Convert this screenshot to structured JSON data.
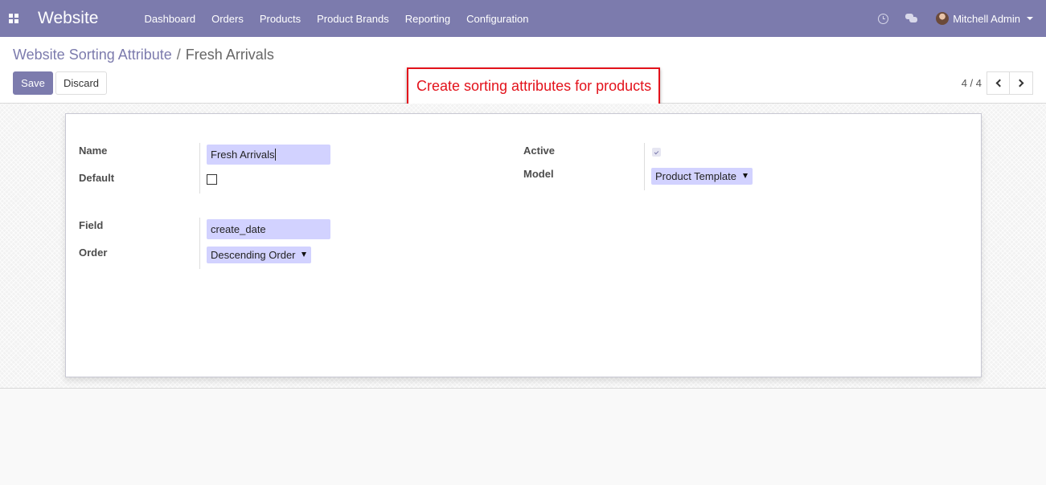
{
  "navbar": {
    "brand": "Website",
    "menu": [
      "Dashboard",
      "Orders",
      "Products",
      "Product Brands",
      "Reporting",
      "Configuration"
    ],
    "user": "Mitchell Admin",
    "color": "#7c7bad"
  },
  "breadcrumb": {
    "parent": "Website Sorting Attribute",
    "separator": "/",
    "current": "Fresh Arrivals"
  },
  "buttons": {
    "save": "Save",
    "discard": "Discard"
  },
  "annotation": "Create sorting attributes for products",
  "pager": {
    "value": "4 / 4"
  },
  "form": {
    "name_label": "Name",
    "name_value": "Fresh Arrivals",
    "default_label": "Default",
    "default_checked": false,
    "active_label": "Active",
    "active_checked": true,
    "model_label": "Model",
    "model_value": "Product Template",
    "field_label": "Field",
    "field_value": "create_date",
    "order_label": "Order",
    "order_value": "Descending Order"
  }
}
